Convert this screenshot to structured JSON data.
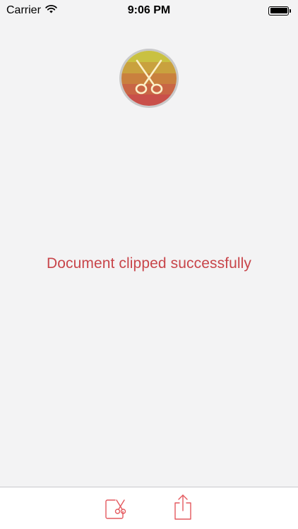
{
  "status_bar": {
    "carrier": "Carrier",
    "time": "9:06 PM",
    "wifi_icon": "wifi-icon",
    "battery_icon": "battery-full-icon"
  },
  "logo": {
    "icon": "scissors-icon",
    "colors": [
      "#c9c141",
      "#c9a13e",
      "#c9803e",
      "#c96645",
      "#c9504a"
    ]
  },
  "message": {
    "text": "Document clipped successfully",
    "color": "#c8454a"
  },
  "toolbar": {
    "accent_color": "#e4595e",
    "items": [
      {
        "icon": "clip-document-icon"
      },
      {
        "icon": "share-icon"
      }
    ]
  }
}
